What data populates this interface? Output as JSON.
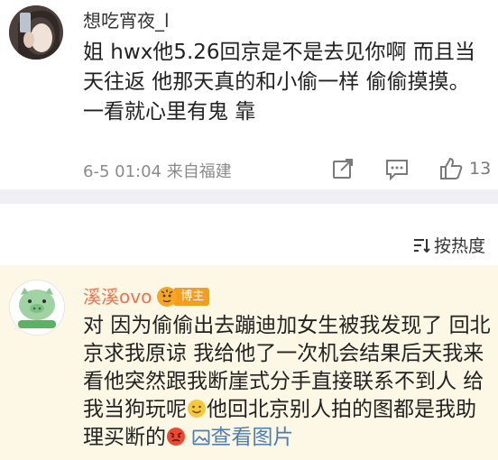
{
  "comment1": {
    "username": "想吃宵夜_l",
    "content": "姐 hwx他5.26回京是不是去见你啊 而且当天往返 他那天真的和小偷一样 偷偷摸摸。一看就心里有鬼 靠",
    "timestamp": "6-5 01:04",
    "source": "来自福建",
    "like_count": "13",
    "actions": [
      "share-icon",
      "comment-icon",
      "like-icon"
    ]
  },
  "sort": {
    "label": "按热度"
  },
  "comment2": {
    "username": "溪溪ovo",
    "badge": "博主",
    "content_part1": "对 因为偷偷出去蹦迪加女生被我发现了 回北京求我原谅 我给他了一次机会结果后天我来看他突然跟我断崖式分手直接联系不到人 给我当狗玩呢",
    "content_part2": "他回北京别人拍的图都是我助理买断的",
    "view_pic": "查看图片"
  },
  "colors": {
    "hot_bg": "#fdf8e6",
    "separator": "#efeff4",
    "username_hot": "#eb7350",
    "link": "#507daf",
    "badge": "#f59d1d"
  }
}
